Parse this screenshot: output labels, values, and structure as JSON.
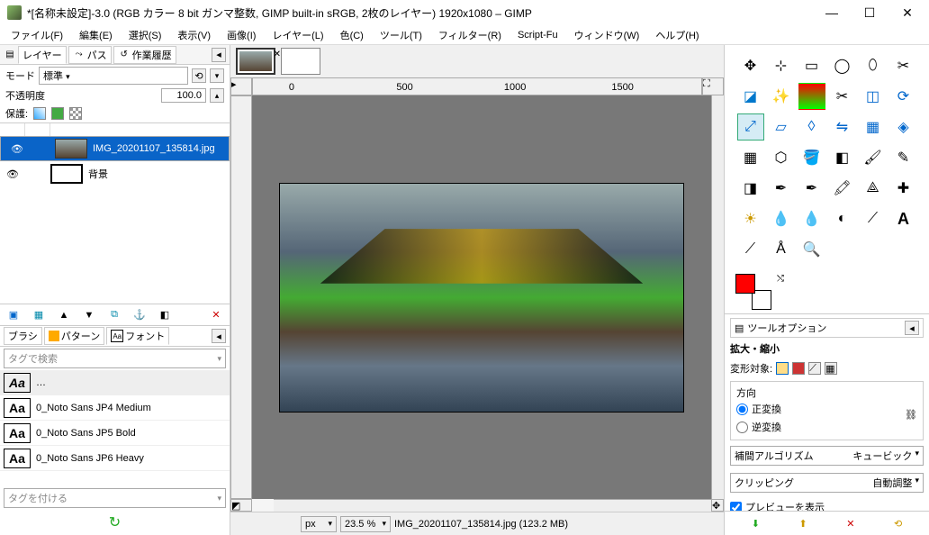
{
  "title": "*[名称未設定]-3.0 (RGB カラー 8 bit ガンマ整数, GIMP built-in sRGB, 2枚のレイヤー) 1920x1080 – GIMP",
  "menubar": [
    "ファイル(F)",
    "編集(E)",
    "選択(S)",
    "表示(V)",
    "画像(I)",
    "レイヤー(L)",
    "色(C)",
    "ツール(T)",
    "フィルター(R)",
    "Script-Fu",
    "ウィンドウ(W)",
    "ヘルプ(H)"
  ],
  "left": {
    "tabs": [
      "レイヤー",
      "パス",
      "作業履歴"
    ],
    "mode_label": "モード",
    "mode_value": "標準",
    "opacity_label": "不透明度",
    "opacity_value": "100.0",
    "lock_label": "保護:",
    "layers": [
      {
        "name": "IMG_20201107_135814.jpg",
        "selected": true
      },
      {
        "name": "背景",
        "selected": false
      }
    ],
    "brush_tabs": [
      "ブラシ",
      "パターン",
      "フォント"
    ],
    "search_placeholder": "タグで検索",
    "fonts": [
      "0_Noto Sans JP4 Medium",
      "0_Noto Sans JP5 Bold",
      "0_Noto Sans JP6 Heavy"
    ],
    "tag_add": "タグを付ける"
  },
  "ruler": {
    "marks": [
      "0",
      "500",
      "1000",
      "1500"
    ]
  },
  "status": {
    "unit": "px",
    "zoom": "23.5 %",
    "info": "IMG_20201107_135814.jpg (123.2 MB)"
  },
  "right": {
    "tool_options_tab": "ツールオプション",
    "current_tool": "拡大・縮小",
    "transform_label": "変形対象:",
    "direction_label": "方向",
    "dir_normal": "正変換",
    "dir_reverse": "逆変換",
    "interp_label": "補間アルゴリズム",
    "interp_value": "キュービック",
    "clip_label": "クリッピング",
    "clip_value": "自動調整",
    "preview_label": "プレビューを表示"
  }
}
